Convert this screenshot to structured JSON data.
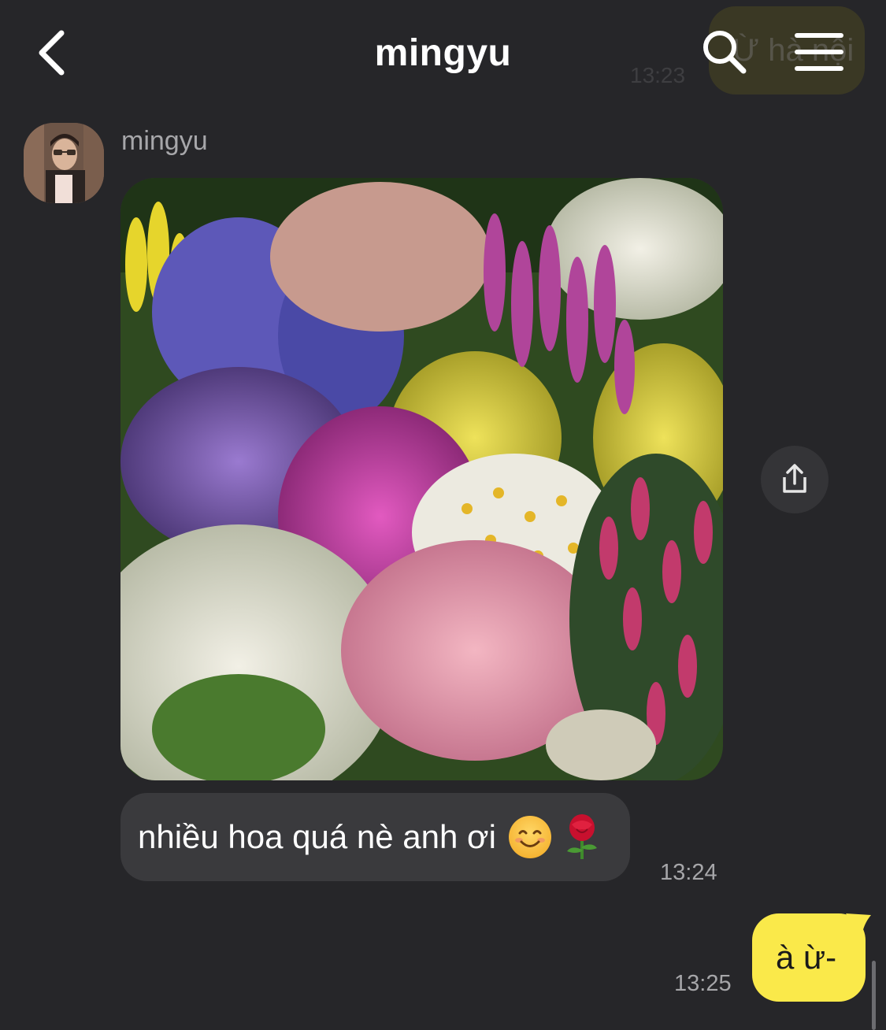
{
  "header": {
    "title": "mingyu",
    "back_icon": "chevron-left-icon",
    "search_icon": "search-icon",
    "menu_icon": "hamburger-menu-icon"
  },
  "previous_message": {
    "text": "Ừ hà nội",
    "time": "13:23"
  },
  "conversation": {
    "sender_name": "mingyu",
    "photo_description": "flower-garden-photo",
    "share_icon": "share-icon",
    "incoming_text": "nhiều hoa quá nè anh ơi",
    "incoming_time": "13:24",
    "outgoing_text": "à ừ-",
    "outgoing_time": "13:25"
  },
  "colors": {
    "background": "#262629",
    "incoming_bubble": "#3a3a3d",
    "outgoing_bubble": "#fae94a",
    "timestamp": "#a6a6a9"
  }
}
